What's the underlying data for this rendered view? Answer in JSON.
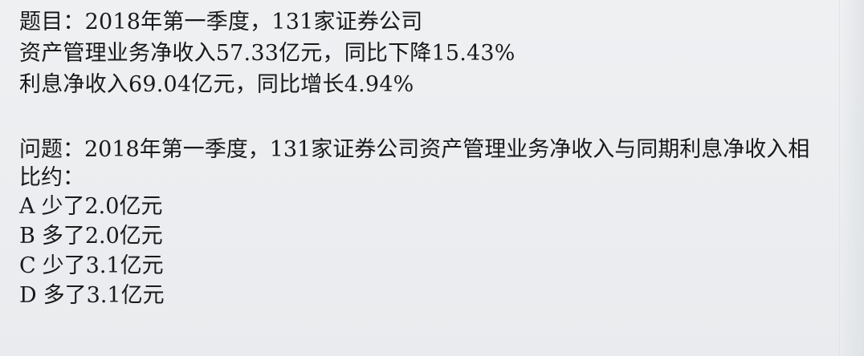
{
  "document": {
    "title_line": "题目：2018年第一季度，131家证券公司",
    "fact_line_1": "资产管理业务净收入57.33亿元，同比下降15.43%",
    "fact_line_2": "利息净收入69.04亿元，同比增长4.94%",
    "question": "问题：2018年第一季度，131家证券公司资产管理业务净收入与同期利息净收入相比约：",
    "options": [
      {
        "letter": "A",
        "text": "少了2.0亿元"
      },
      {
        "letter": "B",
        "text": "多了2.0亿元"
      },
      {
        "letter": "C",
        "text": "少了3.1亿元"
      },
      {
        "letter": "D",
        "text": "多了3.1亿元"
      }
    ]
  }
}
